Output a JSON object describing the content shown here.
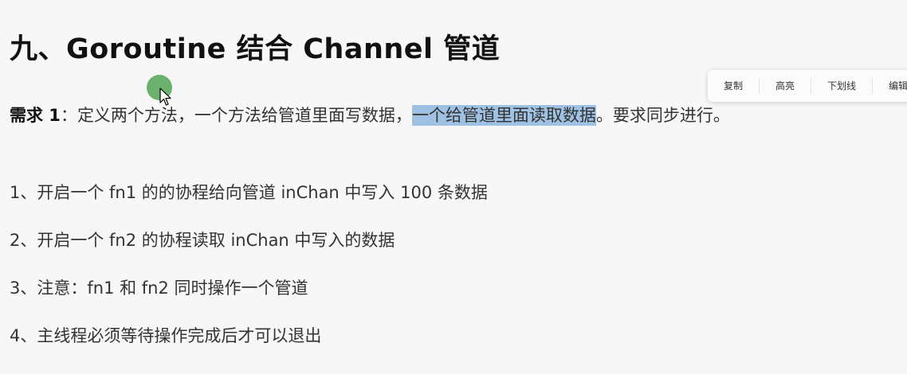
{
  "heading": "九、Goroutine 结合 Channel 管道",
  "requirement": {
    "label": "需求 1",
    "colon": "：",
    "text_before": "定义两个方法，一个方法给管道里面写数据，",
    "highlighted": "一个给管道里面读取数据",
    "text_after": "。要求同步进行。"
  },
  "items": [
    "1、开启一个 fn1 的的协程给向管道 inChan 中写入 100 条数据",
    "2、开启一个 fn2 的协程读取 inChan 中写入的数据",
    "3、注意：fn1 和 fn2 同时操作一个管道",
    "4、主线程必须等待操作完成后才可以退出"
  ],
  "toolbar": {
    "copy_label": "复制",
    "highlight_label": "高亮",
    "underline_label": "下划线",
    "edit_label": "编辑"
  },
  "colors": {
    "selection_highlight": "#9fc2e4",
    "cursor_dot": "#5aa85e"
  }
}
